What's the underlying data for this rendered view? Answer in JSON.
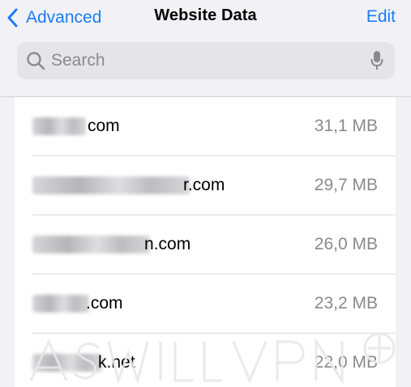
{
  "nav": {
    "back_label": "Advanced",
    "title": "Website Data",
    "edit_label": "Edit"
  },
  "search": {
    "placeholder": "Search"
  },
  "sites": [
    {
      "domain": "com",
      "size": "31,1 MB"
    },
    {
      "domain": "r.com",
      "size": "29,7 MB"
    },
    {
      "domain": "n.com",
      "size": "26,0 MB"
    },
    {
      "domain": ".com",
      "size": "23,2 MB"
    },
    {
      "domain": "k.net",
      "size": "22,0 MB"
    }
  ],
  "colors": {
    "accent": "#1b7cf4",
    "background": "#f2f2f6",
    "secondary_text": "#8a8a8e"
  },
  "icons": {
    "back": "chevron-left-icon",
    "search": "search-icon",
    "mic": "microphone-icon"
  }
}
